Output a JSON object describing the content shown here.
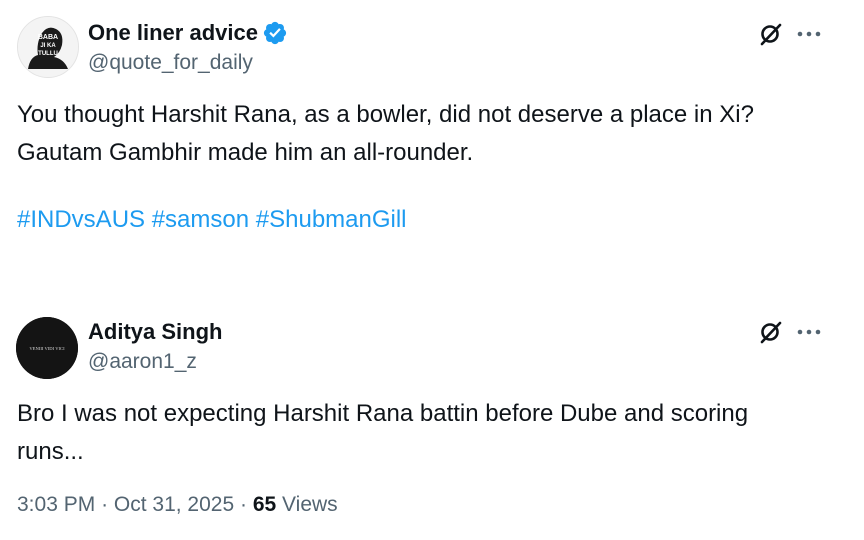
{
  "tweet": {
    "author_name": "One liner advice",
    "author_handle": "@quote_for_daily",
    "avatar_text": [
      "BABA",
      "JI KA",
      "TULLU"
    ],
    "text_lines": [
      "You thought Harshit Rana, as a bowler, did not deserve a place in Xi?",
      "Gautam Gambhir made him an all-rounder."
    ],
    "hashtags": [
      "#INDvsAUS",
      "#samson",
      "#ShubmanGill"
    ]
  },
  "reply": {
    "author_name": "Aditya Singh",
    "author_handle": "@aaron1_z",
    "avatar_text": "VENIII VIDI VICI",
    "text_lines": [
      "Bro I was not expecting Harshit Rana battin before Dube and scoring",
      "runs..."
    ],
    "time": "3:03 PM",
    "sep1": "·",
    "date": "Oct 31, 2025",
    "sep2": "·",
    "views_count": "65",
    "views_label": "Views"
  },
  "colors": {
    "accent": "#1d9bf0",
    "text_primary": "#0f1419",
    "text_secondary": "#536471"
  },
  "icons": {
    "verified": "verified-badge-icon",
    "grok": "grok-icon",
    "more": "more-icon"
  }
}
